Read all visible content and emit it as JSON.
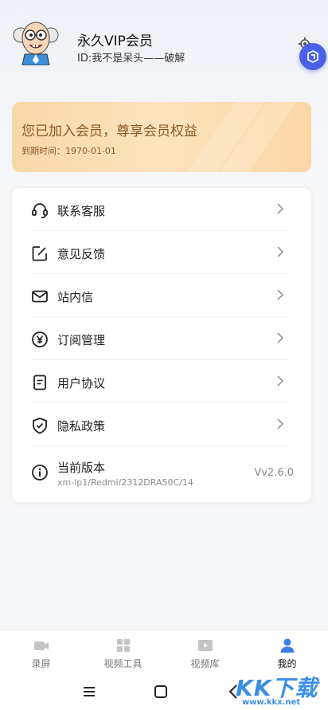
{
  "profile": {
    "name": "永久VIP会员",
    "id_text": "ID:我不是呆头——破解"
  },
  "vip": {
    "title": "您已加入会员，尊享会员权益",
    "expire": "到期时间：1970-01-01"
  },
  "menu": {
    "items": [
      {
        "label": "联系客服",
        "icon": "headset-icon"
      },
      {
        "label": "意见反馈",
        "icon": "edit-icon"
      },
      {
        "label": "站内信",
        "icon": "mail-icon"
      },
      {
        "label": "订阅管理",
        "icon": "yen-icon"
      },
      {
        "label": "用户协议",
        "icon": "document-icon"
      },
      {
        "label": "隐私政策",
        "icon": "shield-icon"
      }
    ],
    "version": {
      "label": "当前版本",
      "device": "xm-lp1/Redmi/2312DRA50C/14",
      "value": "Vv2.6.0",
      "icon": "info-icon"
    }
  },
  "tabs": [
    {
      "label": "录屏",
      "icon": "video-icon",
      "active": false
    },
    {
      "label": "视频工具",
      "icon": "grid-icon",
      "active": false
    },
    {
      "label": "视频库",
      "icon": "play-folder-icon",
      "active": false
    },
    {
      "label": "我的",
      "icon": "person-icon",
      "active": true
    }
  ],
  "watermark": {
    "main": "KK下载",
    "url": "www.kkx.net"
  },
  "colors": {
    "accent": "#3a7ee8",
    "vip_text": "#8a5a25",
    "vip_gradient_start": "#f9d8a8",
    "vip_gradient_end": "#fbd7a6",
    "badge": "#4a62e8"
  }
}
